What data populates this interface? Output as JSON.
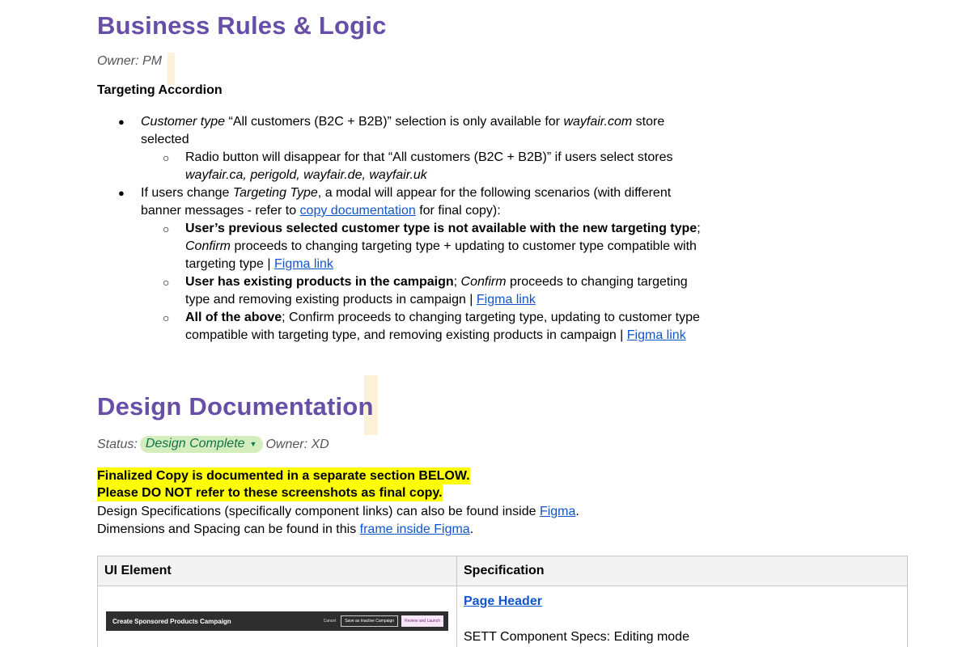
{
  "business": {
    "title": "Business Rules & Logic",
    "owner": "Owner: PM",
    "subhead": "Targeting Accordion",
    "bullet1": {
      "em": "Customer type",
      "text_a": " “All customers (B2C + B2B)” selection is only available for ",
      "em2": "wayfair.com",
      "text_b": " store",
      "line2": "selected",
      "sub": {
        "line1": "Radio button will disappear for that “All customers (B2C + B2B)” if users select stores",
        "line2": "wayfair.ca, perigold, wayfair.de, wayfair.uk"
      }
    },
    "bullet2": {
      "text_a": "If users change ",
      "em": "Targeting Type",
      "text_b": ", a modal will appear for the following scenarios (with different",
      "line2_a": "banner messages - refer to ",
      "line2_link": "copy documentation",
      "line2_b": " for final copy):",
      "sub1": {
        "bold": "User’s previous selected customer type is not available with the new targeting type",
        "tail": ";",
        "line2_em": "Confirm",
        "line2": " proceeds to changing targeting type + updating to customer type compatible with",
        "line3": "targeting type | ",
        "link": "Figma link"
      },
      "sub2": {
        "bold": "User has existing products in the campaign",
        "sep": "; ",
        "em": "Confirm",
        "text": " proceeds to changing targeting",
        "line2": "type and removing existing products in campaign | ",
        "link": "Figma link"
      },
      "sub3": {
        "bold": "All of the above",
        "text": "; Confirm proceeds to changing targeting type, updating to customer type",
        "line2": "compatible with targeting type, and removing existing products in campaign | ",
        "link": "Figma link"
      }
    }
  },
  "design": {
    "title": "Design Documentation",
    "status_label": "Status:",
    "status_value": "Design Complete",
    "owner": "Owner: XD",
    "highlight1": "Finalized Copy is documented in a separate section BELOW.",
    "highlight2": "Please DO NOT refer to these screenshots as final copy.",
    "spec_a": "Design Specifications (specifically component links) can also be found inside ",
    "spec_link": "Figma",
    "spec_b": ".",
    "dim_a": "Dimensions and Spacing can be found in this ",
    "dim_link": "frame inside Figma",
    "dim_b": "."
  },
  "table": {
    "headers": [
      "UI Element",
      "Specification"
    ],
    "row1": {
      "mini_title": "Create Sponsored Products Campaign",
      "mini_cancel": "Cancel",
      "mini_save": "Save as Inactive Campaign",
      "mini_review": "Review and Launch",
      "link": "Page Header",
      "text": "SETT Component Specs: Editing mode"
    }
  },
  "colors": {
    "heading": "#674ea7",
    "link": "#1155cc",
    "highlight": "#ffff00",
    "chip_bg": "#d4edbc"
  }
}
